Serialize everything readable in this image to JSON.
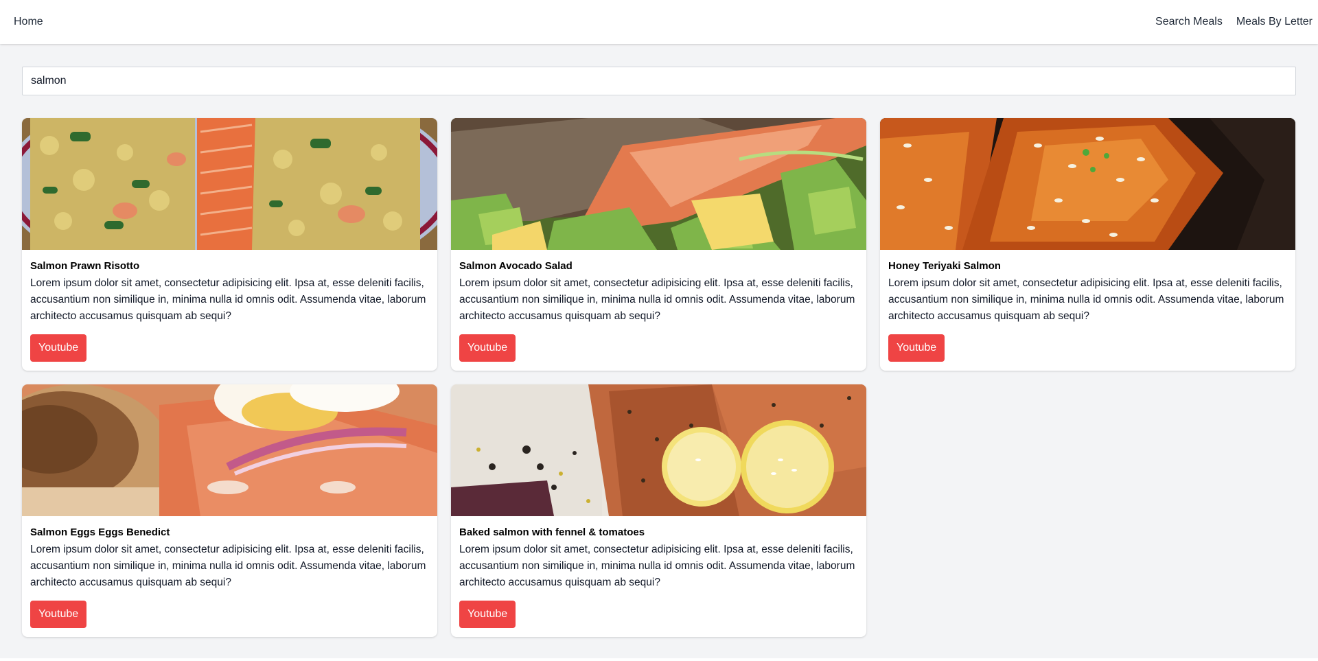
{
  "nav": {
    "home_label": "Home",
    "search_meals_label": "Search Meals",
    "meals_by_letter_label": "Meals By Letter"
  },
  "search": {
    "value": "salmon"
  },
  "meals": [
    {
      "title": "Salmon Prawn Risotto",
      "description": "Lorem ipsum dolor sit amet, consectetur adipisicing elit. Ipsa at, esse deleniti facilis, accusantium non similique in, minima nulla id omnis odit. Assumenda vitae, laborum architecto accusamus quisquam ab sequi?",
      "button_label": "Youtube"
    },
    {
      "title": "Salmon Avocado Salad",
      "description": "Lorem ipsum dolor sit amet, consectetur adipisicing elit. Ipsa at, esse deleniti facilis, accusantium non similique in, minima nulla id omnis odit. Assumenda vitae, laborum architecto accusamus quisquam ab sequi?",
      "button_label": "Youtube"
    },
    {
      "title": "Honey Teriyaki Salmon",
      "description": "Lorem ipsum dolor sit amet, consectetur adipisicing elit. Ipsa at, esse deleniti facilis, accusantium non similique in, minima nulla id omnis odit. Assumenda vitae, laborum architecto accusamus quisquam ab sequi?",
      "button_label": "Youtube"
    },
    {
      "title": "Salmon Eggs Eggs Benedict",
      "description": "Lorem ipsum dolor sit amet, consectetur adipisicing elit. Ipsa at, esse deleniti facilis, accusantium non similique in, minima nulla id omnis odit. Assumenda vitae, laborum architecto accusamus quisquam ab sequi?",
      "button_label": "Youtube"
    },
    {
      "title": "Baked salmon with fennel & tomatoes",
      "description": "Lorem ipsum dolor sit amet, consectetur adipisicing elit. Ipsa at, esse deleniti facilis, accusantium non similique in, minima nulla id omnis odit. Assumenda vitae, laborum architecto accusamus quisquam ab sequi?",
      "button_label": "Youtube"
    }
  ],
  "colors": {
    "button": "#ef4444",
    "page_background": "#f3f4f6",
    "card_background": "#ffffff"
  }
}
